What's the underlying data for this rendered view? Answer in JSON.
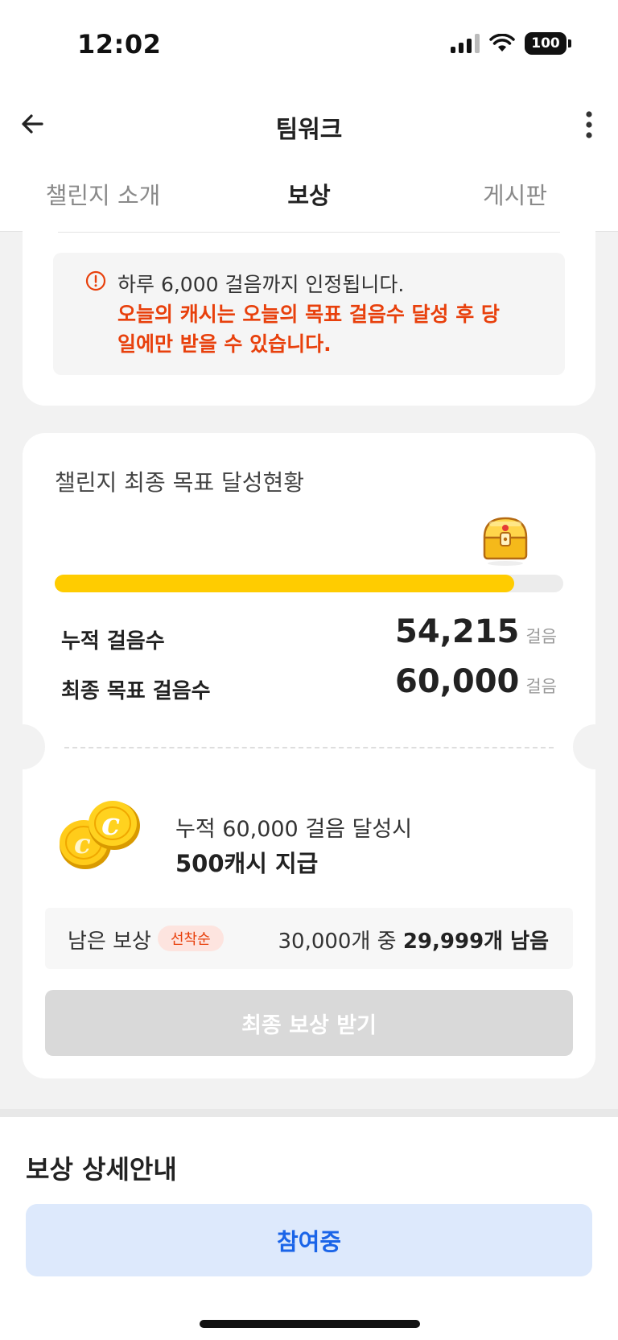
{
  "status_bar": {
    "time": "12:02",
    "battery": "100"
  },
  "header": {
    "title": "팀워크"
  },
  "tabs": [
    {
      "label": "챌린지 소개"
    },
    {
      "label": "보상"
    },
    {
      "label": "게시판"
    }
  ],
  "notice": {
    "line1": "하루 6,000 걸음까지 인정됩니다.",
    "warning": "오늘의 캐시는 오늘의 목표 걸음수 달성 후 당일에만 받을 수 있습니다."
  },
  "goal": {
    "title": "챌린지 최종 목표 달성현황",
    "progress_percent": 90.4,
    "cumulative_label": "누적 걸음수",
    "cumulative_value": "54,215",
    "target_label": "최종 목표 걸음수",
    "target_value": "60,000",
    "unit": "걸음"
  },
  "reward": {
    "condition": "누적 60,000 걸음 달성시",
    "amount": "500캐시 지급",
    "remain_label": "남은 보상",
    "remain_badge": "선착순",
    "remain_total": "30,000개 중",
    "remain_count": "29,999개 남음",
    "claim_label": "최종 보상 받기"
  },
  "details": {
    "title": "보상 상세안내",
    "join_label": "참여중"
  },
  "colors": {
    "accent_orange": "#e8400c",
    "progress_yellow": "#ffcc00",
    "join_blue": "#1a64e8"
  }
}
